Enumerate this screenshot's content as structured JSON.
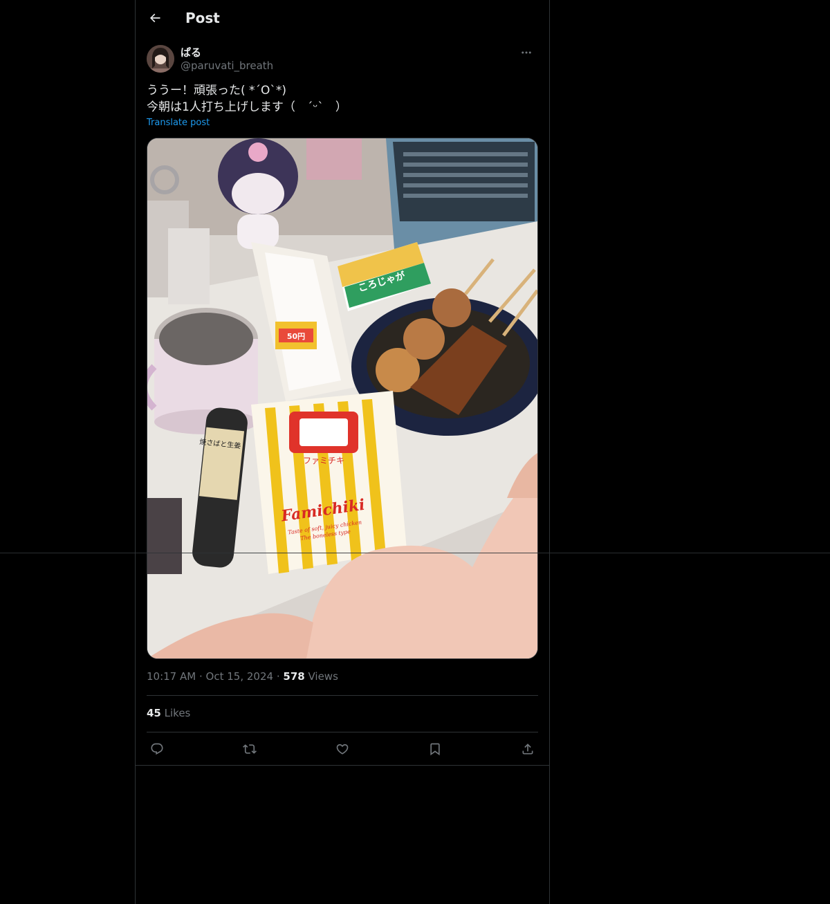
{
  "header": {
    "title": "Post",
    "back_icon": "arrow-left-icon"
  },
  "author": {
    "display_name": "ぱる",
    "handle": "@paruvati_breath",
    "more_icon": "more-horizontal-icon"
  },
  "tweet": {
    "text": "ううー！頑張った( *ˊOˋ*)\n今朝は1人打ち上げします（　ˊᵕˋ　）",
    "translate_label": "Translate post"
  },
  "media": {
    "package_label_1": "ファミチキ",
    "package_label_2": "Famichiki",
    "package_label_3": "Taste of soft, juicy chicken",
    "package_label_4": "The boneless type",
    "snack_label": "ころじゃが",
    "sandwich_label": "50円",
    "onigiri_label": "焼さばと生姜"
  },
  "meta": {
    "time": "10:17 AM",
    "date": "Oct 15, 2024",
    "separator": "·",
    "views_count": "578",
    "views_label": "Views"
  },
  "likes": {
    "count": "45",
    "label": "Likes"
  },
  "actions": {
    "reply_icon": "reply-icon",
    "repost_icon": "repost-icon",
    "like_icon": "heart-icon",
    "bookmark_icon": "bookmark-icon",
    "share_icon": "share-icon"
  },
  "colors": {
    "background": "#000000",
    "text": "#e7e9ea",
    "secondary_text": "#71767b",
    "link": "#1d9bf0",
    "border": "#2f3336"
  }
}
